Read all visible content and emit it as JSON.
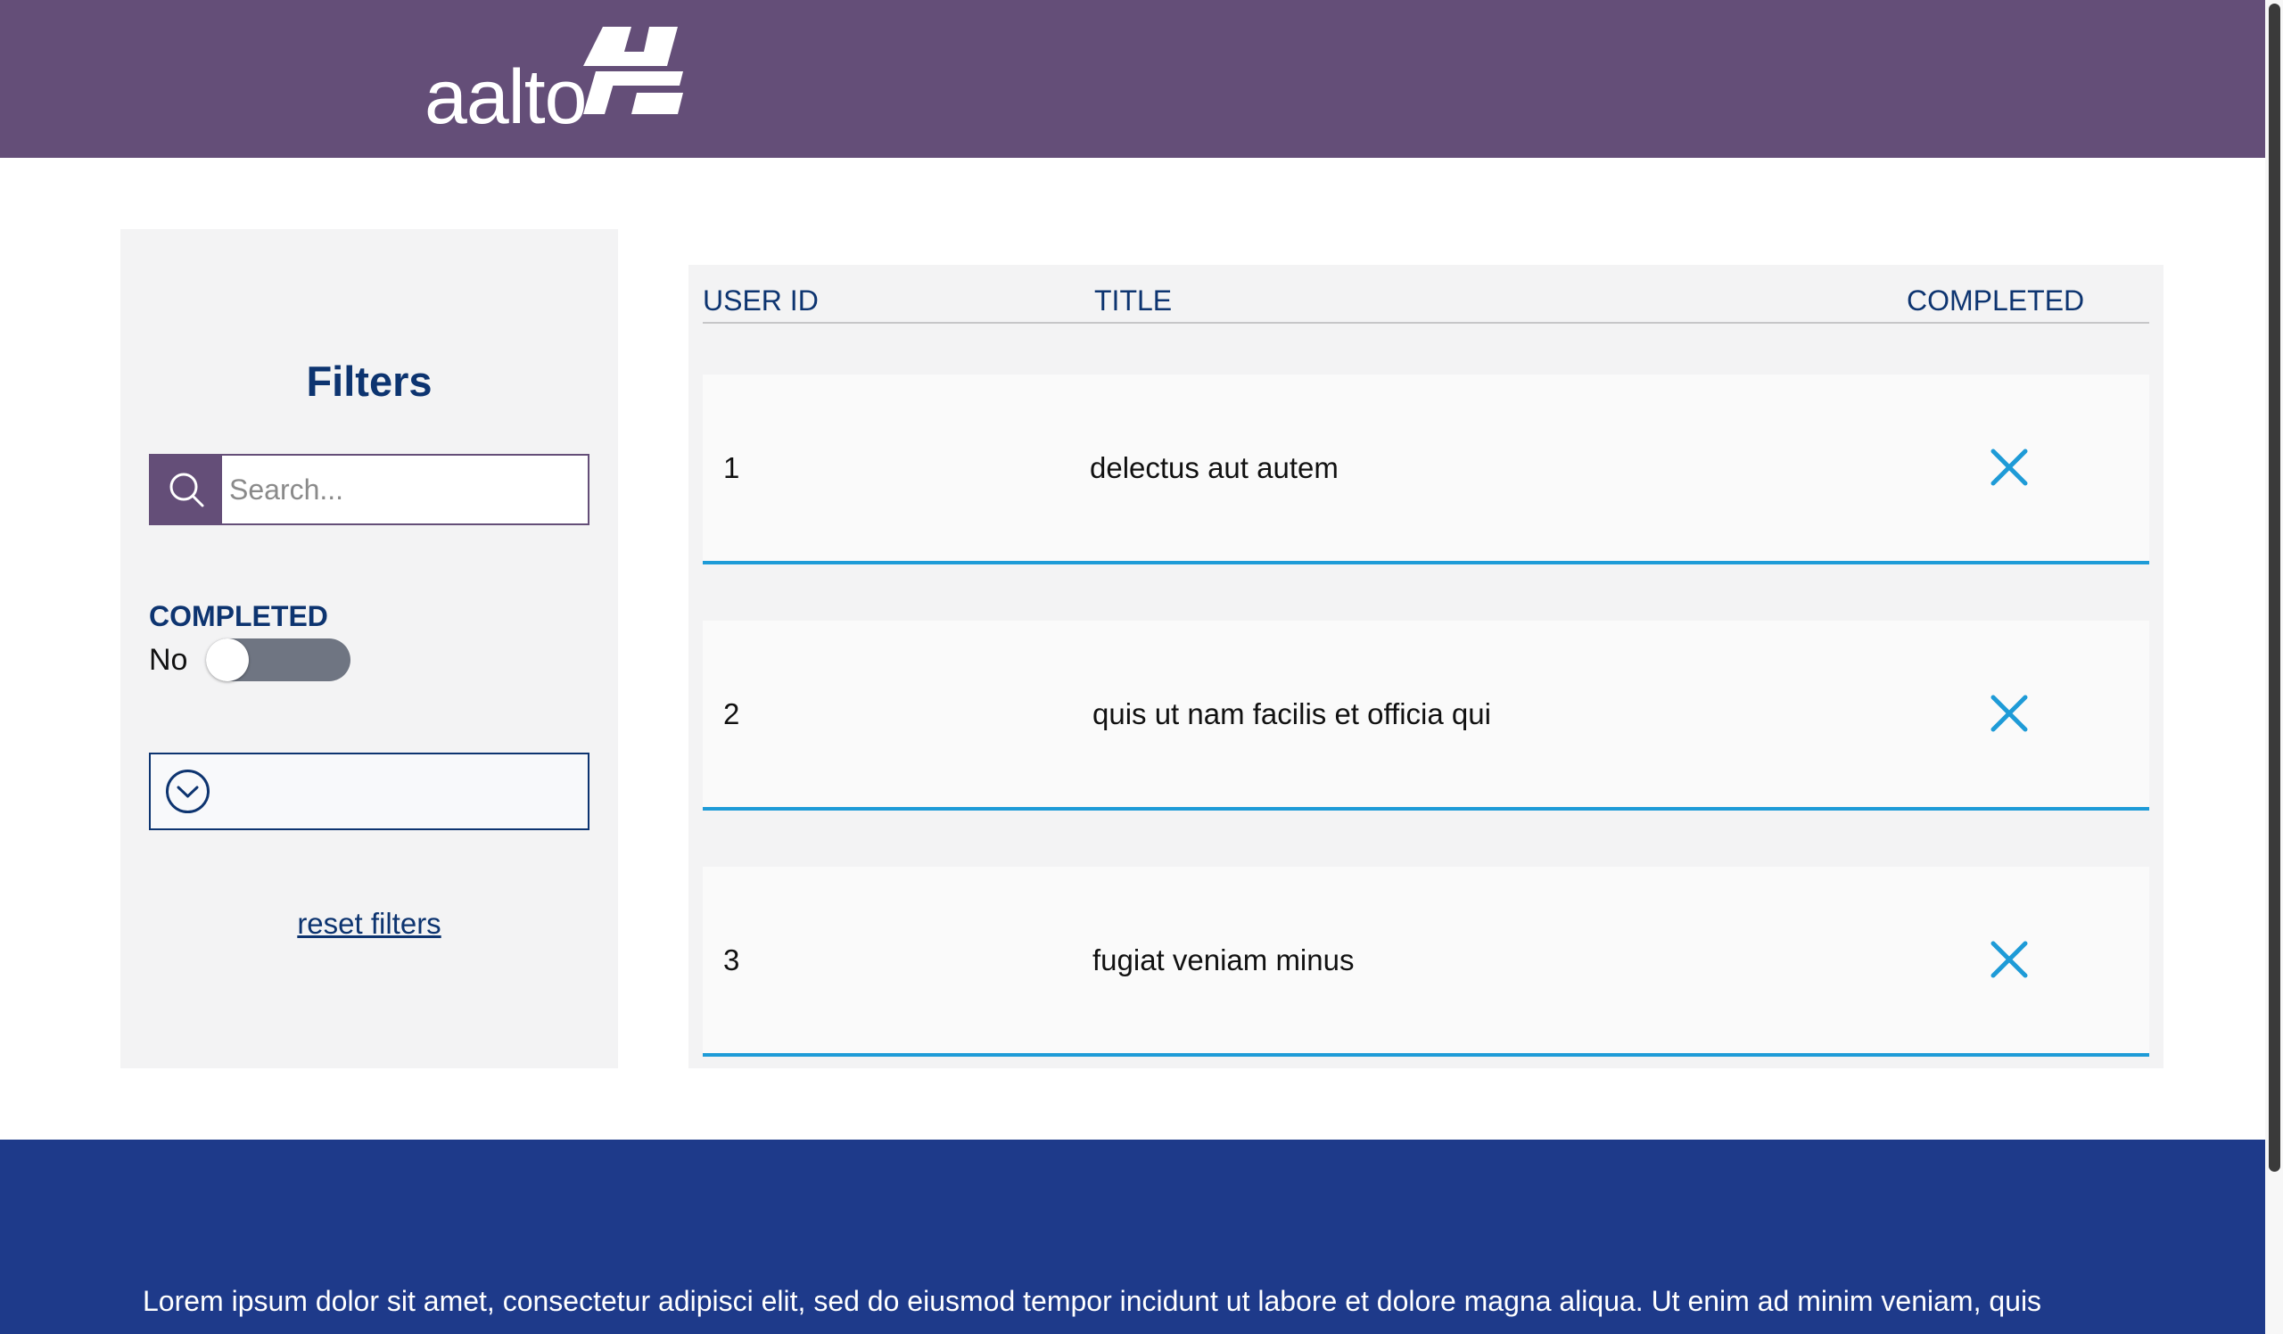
{
  "colors": {
    "brand": "#644e78",
    "navy": "#0d3470",
    "accent": "#1e9bd7",
    "footer": "#1e3a8a"
  },
  "header": {
    "logo_text": "aalto",
    "logo_icon": "aalto-mark-icon"
  },
  "filters": {
    "title": "Filters",
    "search": {
      "icon": "search-icon",
      "value": "",
      "placeholder": "Search..."
    },
    "completed": {
      "label": "COMPLETED",
      "state_text": "No",
      "checked": false
    },
    "dropdown": {
      "icon": "chevron-down-circle-icon",
      "selected": ""
    },
    "reset_label": "reset filters"
  },
  "table": {
    "columns": [
      "USER ID",
      "TITLE",
      "COMPLETED"
    ],
    "rows": [
      {
        "user_id": "1",
        "title": "delectus aut autem",
        "completed": false,
        "completed_icon": "x-icon"
      },
      {
        "user_id": "2",
        "title": "quis ut nam facilis et officia qui",
        "completed": false,
        "completed_icon": "x-icon"
      },
      {
        "user_id": "3",
        "title": "fugiat veniam minus",
        "completed": false,
        "completed_icon": "x-icon"
      }
    ]
  },
  "footer": {
    "text": "Lorem ipsum dolor sit amet, consectetur adipisci elit, sed do eiusmod tempor incidunt ut labore et dolore magna aliqua. Ut enim ad minim veniam, quis"
  }
}
